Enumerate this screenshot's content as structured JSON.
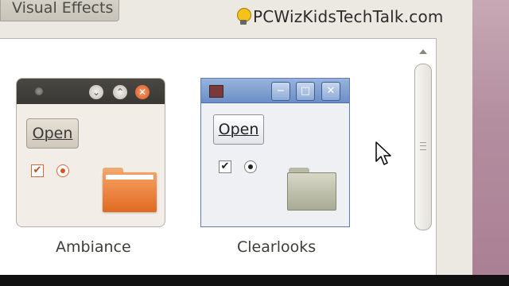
{
  "tab": {
    "label": "Visual Effects"
  },
  "watermark": {
    "text": "PCWizKidsTechTalk.com"
  },
  "themes": [
    {
      "name": "Ambiance",
      "open_label": "Open",
      "checkbox": "✔",
      "min_glyph": "⌄",
      "max_glyph": "⌃",
      "close_glyph": "✕"
    },
    {
      "name": "Clearlooks",
      "open_label": "Open",
      "checkbox": "✔",
      "min_glyph": "−",
      "max_glyph": "□",
      "close_glyph": "✕"
    }
  ],
  "colors": {
    "ambiance_accent": "#e06a22",
    "clearlooks_title": "#6b8fc6",
    "desktop": "#b48fa0"
  }
}
